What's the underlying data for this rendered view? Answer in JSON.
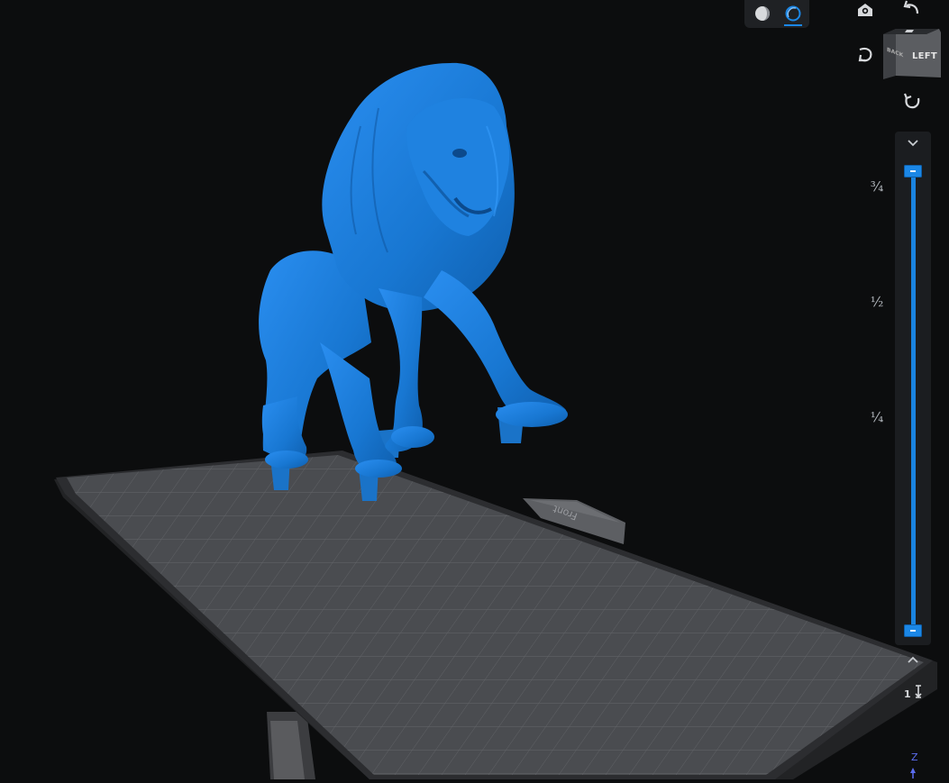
{
  "view_modes": {
    "active": "xray",
    "items": [
      {
        "icon": "shaded-sphere-icon",
        "tooltip": ""
      },
      {
        "icon": "xray-sphere-icon",
        "tooltip": ""
      }
    ]
  },
  "camera_tools": {
    "home": "camera-home-icon",
    "undo": "undo-arrow-icon",
    "rotate_left": "rotate-left-icon",
    "rotate_right": "rotate-right-icon"
  },
  "view_cube": {
    "front_face": "LEFT",
    "side_face": "BACK"
  },
  "build_plate": {
    "label": "Front"
  },
  "layer_slider": {
    "ticks": [
      "¾",
      "½",
      "¼"
    ],
    "range_top_fraction": 1.0,
    "range_bottom_fraction": 0.0
  },
  "axis": {
    "z_label": "Z"
  },
  "colors": {
    "model": "#1b7dd8",
    "accent": "#1b87e6",
    "background": "#0c0d0e",
    "plate": "#4a4c50"
  }
}
